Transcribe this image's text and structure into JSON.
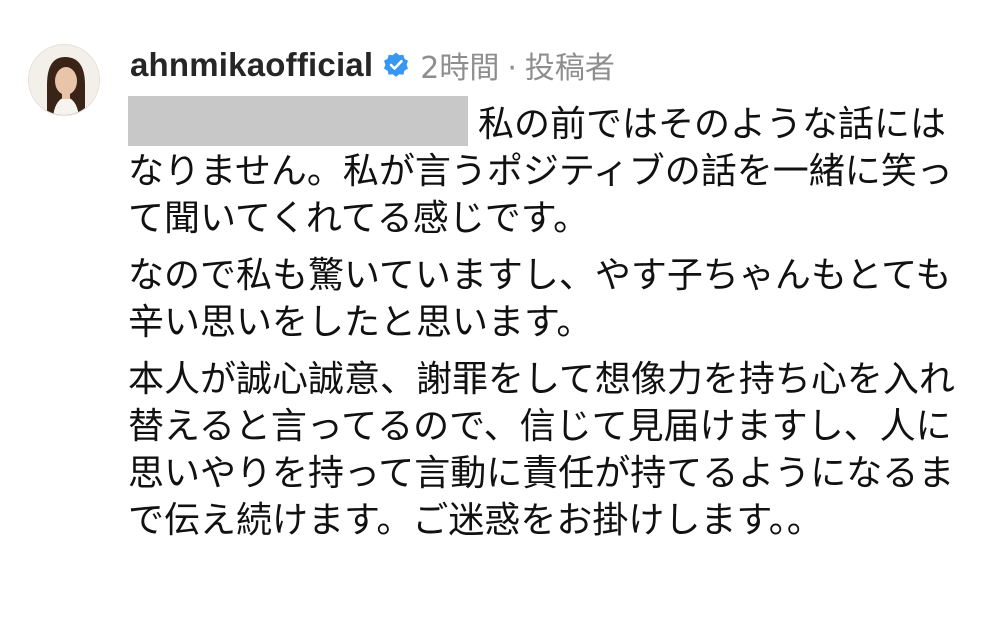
{
  "comment": {
    "username": "ahnmikaofficial",
    "time": "2時間",
    "separator": "·",
    "role": "投稿者",
    "paragraphs": [
      "私の前ではそのような話にはなりません。私が言うポジティブの話を一緒に笑って聞いてくれてる感じです。",
      "なので私も驚いていますし、やす子ちゃんもとても辛い思いをしたと思います。",
      "本人が誠心誠意、謝罪をして想像力を持ち心を入れ替えると言ってるので、信じて見届けますし、人に思いやりを持って言動に責任が持てるようになるまで伝え続けます。ご迷惑をお掛けします。。"
    ]
  },
  "icons": {
    "avatar": "profile-photo",
    "verified": "verified-badge-icon"
  },
  "colors": {
    "verified_blue": "#3897f0",
    "meta_gray": "#8e8e8e",
    "redaction_gray": "#c8c8c8"
  }
}
